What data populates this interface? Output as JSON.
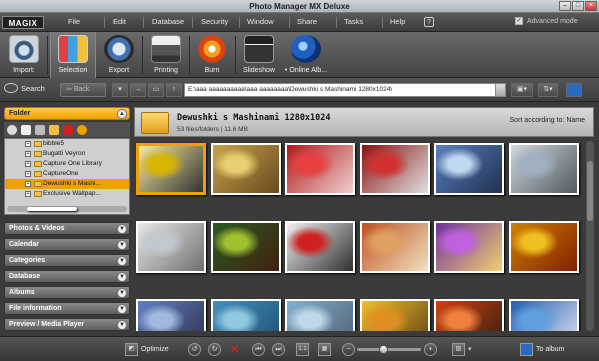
{
  "window": {
    "title": "Photo Manager MX Deluxe"
  },
  "menubar": {
    "logo": "MAGIX",
    "items": [
      "File",
      "Edit",
      "Database",
      "Security",
      "Window",
      "Share",
      "Tasks",
      "Help"
    ],
    "advanced_mode": "Advanced mode"
  },
  "toolbar": {
    "tools": [
      {
        "label": "Import:",
        "icon": "camera-icon"
      },
      {
        "label": "Selection",
        "icon": "photos-grid-icon"
      },
      {
        "label": "Export",
        "icon": "export-arrows-icon"
      },
      {
        "label": "Printing",
        "icon": "printer-icon"
      },
      {
        "label": "Burn",
        "icon": "disc-burn-icon"
      },
      {
        "label": "Slideshow",
        "icon": "clapperboard-icon"
      },
      {
        "label": "• Online Alb...",
        "icon": "online-album-icon"
      }
    ]
  },
  "addressbar": {
    "search_label": "Search",
    "back_label": "Back",
    "path": "E:\\ааа аааааааааа\\ааа аааааааа\\Dewushki s Mashinami 1280x1024\\"
  },
  "left": {
    "folder_header": "Folder",
    "tree": [
      {
        "label": "bibble5",
        "selected": false
      },
      {
        "label": "Bugatti Veyron",
        "selected": false
      },
      {
        "label": "Capture One Library",
        "selected": false
      },
      {
        "label": "CaptureOne",
        "selected": false
      },
      {
        "label": "Dewushki s Mashi...",
        "selected": true
      },
      {
        "label": "Exclusive Wallpap...",
        "selected": false
      }
    ],
    "sections": [
      "Photos & Videos",
      "Calendar",
      "Categories",
      "Database",
      "Albums",
      "File information",
      "Preview / Media Player"
    ]
  },
  "main": {
    "folder_name": "Dewushki s Mashinami 1280x1024",
    "folder_count": "53 files/folders | 11.6 MB",
    "sort": "Sort according to: Name",
    "thumbnails": [
      {
        "colors": [
          "#f5e9a0",
          "#d9b500",
          "#333"
        ]
      },
      {
        "colors": [
          "#c8a24a",
          "#e8d070",
          "#6a4a20"
        ]
      },
      {
        "colors": [
          "#b01818",
          "#e84040",
          "#f0d0d0"
        ]
      },
      {
        "colors": [
          "#8a1010",
          "#d03030",
          "#e0e0e0"
        ]
      },
      {
        "colors": [
          "#5a80c0",
          "#c0d8f0",
          "#203050"
        ]
      },
      {
        "colors": [
          "#d0d8e0",
          "#a0b0c0",
          "#505a60"
        ]
      },
      {
        "colors": [
          "#e8e8e8",
          "#c0c8d0",
          "#707070"
        ]
      },
      {
        "colors": [
          "#2a5a20",
          "#a0c030",
          "#402010"
        ]
      },
      {
        "colors": [
          "#f0f0f0",
          "#d02020",
          "#303030"
        ]
      },
      {
        "colors": [
          "#c05020",
          "#e0a060",
          "#f0e0c0"
        ]
      },
      {
        "colors": [
          "#7030a0",
          "#c060e0",
          "#f0d070"
        ]
      },
      {
        "colors": [
          "#d08000",
          "#f0c020",
          "#802000"
        ]
      },
      {
        "colors": [
          "#6080c0",
          "#a0b8e0",
          "#303050"
        ]
      },
      {
        "colors": [
          "#4090c0",
          "#90c8e0",
          "#205070"
        ]
      },
      {
        "colors": [
          "#80b0d0",
          "#c0d8e8",
          "#506070"
        ]
      },
      {
        "colors": [
          "#f0c030",
          "#e09020",
          "#604010"
        ]
      },
      {
        "colors": [
          "#d04010",
          "#f08040",
          "#302010"
        ]
      },
      {
        "colors": [
          "#2060b0",
          "#60a0e0",
          "#e0e0f0"
        ]
      }
    ]
  },
  "bottombar": {
    "optimize_label": "Optimize",
    "to_album_label": "To album"
  }
}
